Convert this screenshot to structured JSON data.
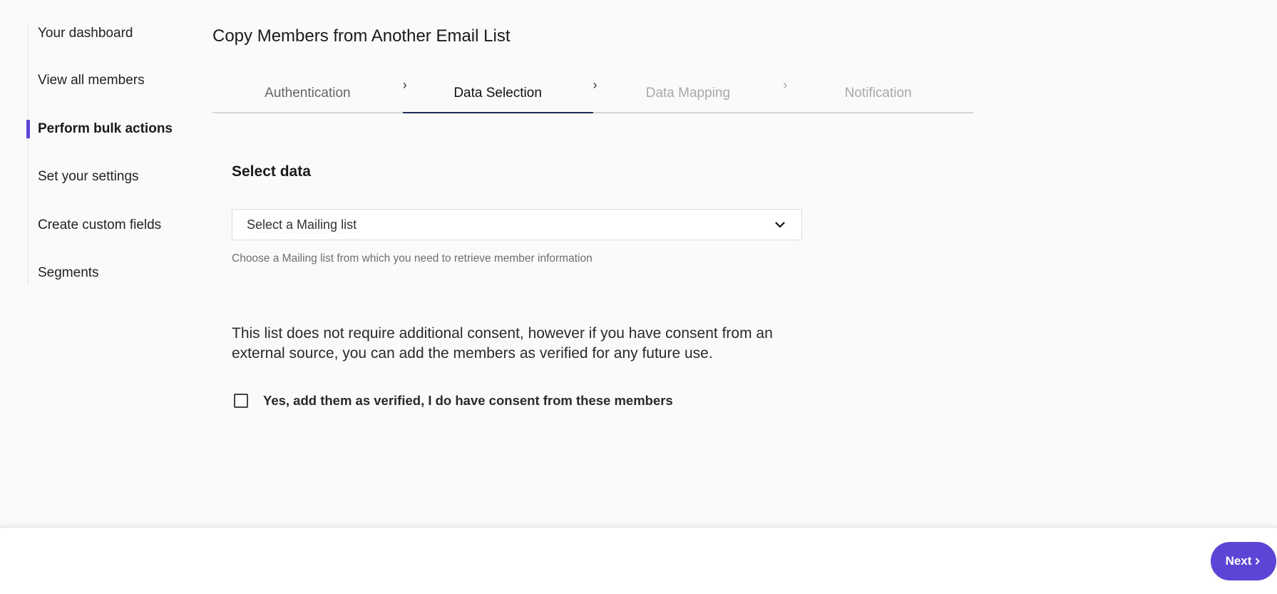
{
  "sidebar": {
    "items": [
      {
        "label": "Your dashboard"
      },
      {
        "label": "View all members"
      },
      {
        "label": "Perform bulk actions"
      },
      {
        "label": "Set your settings"
      },
      {
        "label": "Create custom fields"
      },
      {
        "label": "Segments"
      }
    ],
    "active_index": 2,
    "accent_color": "#5b45d6"
  },
  "page": {
    "title": "Copy Members from Another Email List"
  },
  "stepper": {
    "steps": [
      {
        "label": "Authentication",
        "state": "completed"
      },
      {
        "label": "Data Selection",
        "state": "active"
      },
      {
        "label": "Data Mapping",
        "state": "disabled"
      },
      {
        "label": "Notification",
        "state": "disabled"
      }
    ],
    "separator_icon": "chevron-right-icon"
  },
  "select_data": {
    "title": "Select data",
    "dropdown": {
      "value": "Select a Mailing list",
      "icon": "chevron-down-icon"
    },
    "help_text": "Choose a Mailing list from which you need to retrieve member information"
  },
  "consent": {
    "text": "This list does not require additional consent, however if you have consent from an external source, you can add the members as verified for any future use.",
    "checkbox_label": "Yes, add them as verified, I do have consent from these members",
    "checked": false
  },
  "footer": {
    "next_label": "Next",
    "next_icon": "chevron-right-icon",
    "button_color": "#5b45d6"
  }
}
